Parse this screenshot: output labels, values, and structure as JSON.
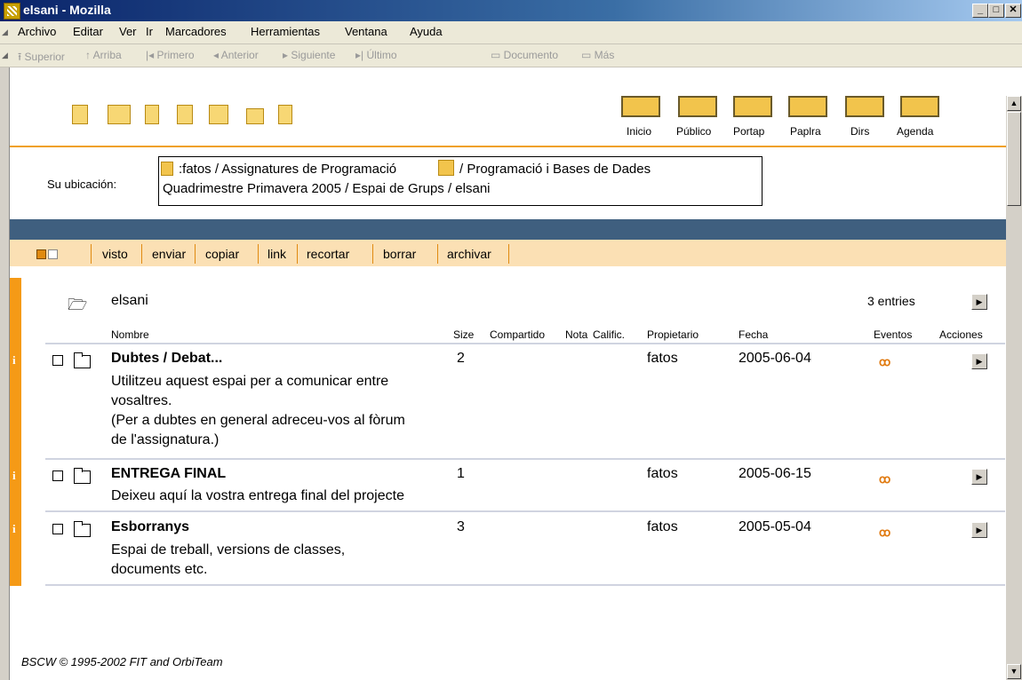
{
  "window": {
    "title": "elsani - Mozilla",
    "min": "_",
    "max": "□",
    "close": "✕"
  },
  "menu": [
    "Archivo",
    "Editar",
    "Ver",
    "Ir",
    "Marcadores",
    "Herramientas",
    "Ventana",
    "Ayuda"
  ],
  "nav": [
    "Superior",
    "Arriba",
    "Primero",
    "Anterior",
    "Siguiente",
    "Último",
    "Documento",
    "Más"
  ],
  "topnav": [
    "Inicio",
    "Público",
    "Portap",
    "Paplra",
    "Dirs",
    "Agenda"
  ],
  "location": {
    "label": "Su ubicación:",
    "line1a": ":fatos / Assignatures de Programació",
    "line1b": "/ Programació i Bases de Dades",
    "line2": "Quadrimestre Primavera 2005 / Espai de Grups / elsani"
  },
  "actions": [
    "visto",
    "enviar",
    "copiar",
    "link",
    "recortar",
    "borrar",
    "archivar"
  ],
  "folder": {
    "name": "elsani",
    "entries": "3 entries"
  },
  "columns": {
    "name": "Nombre",
    "size": "Size",
    "shared": "Compartido",
    "note": "Nota",
    "rating": "Calific.",
    "owner": "Propietario",
    "date": "Fecha",
    "events": "Eventos",
    "actions": "Acciones"
  },
  "rows": [
    {
      "name": "Dubtes / Debat...",
      "desc": [
        "Utilitzeu aquest espai per a comunicar entre",
        "vosaltres.",
        "(Per a dubtes en general adreceu-vos al fòrum",
        "de l'assignatura.)"
      ],
      "size": "2",
      "owner": "fatos",
      "date": "2005-06-04"
    },
    {
      "name": "ENTREGA FINAL",
      "desc": [
        "Deixeu aquí la vostra entrega final del projecte"
      ],
      "size": "1",
      "owner": "fatos",
      "date": "2005-06-15"
    },
    {
      "name": "Esborranys",
      "desc": [
        "Espai de treball, versions de classes,",
        "documents etc."
      ],
      "size": "3",
      "owner": "fatos",
      "date": "2005-05-04"
    }
  ],
  "footer": "BSCW © 1995-2002 FIT and OrbiTeam",
  "icons": {
    "events": "glasses-icon",
    "info": "info-icon",
    "folder": "folder-icon"
  }
}
